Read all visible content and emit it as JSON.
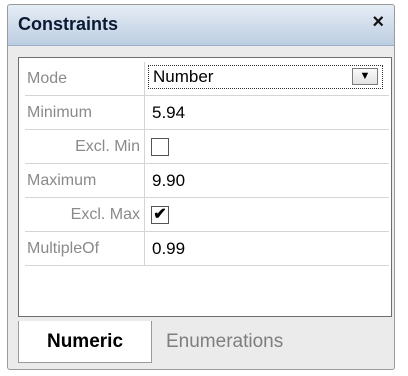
{
  "window": {
    "title": "Constraints",
    "close_glyph": "×"
  },
  "properties": [
    {
      "label": "Mode",
      "type": "select",
      "value": "Number"
    },
    {
      "label": "Minimum",
      "type": "text",
      "value": "5.94"
    },
    {
      "label": "Excl. Min",
      "type": "checkbox",
      "checked": false
    },
    {
      "label": "Maximum",
      "type": "text",
      "value": "9.90"
    },
    {
      "label": "Excl. Max",
      "type": "checkbox",
      "checked": true,
      "glyph": "✔"
    },
    {
      "label": "MultipleOf",
      "type": "text",
      "value": "0.99"
    }
  ],
  "dropdown_arrow": "▼",
  "tabs": [
    {
      "label": "Numeric",
      "active": true
    },
    {
      "label": "Enumerations",
      "active": false
    }
  ]
}
